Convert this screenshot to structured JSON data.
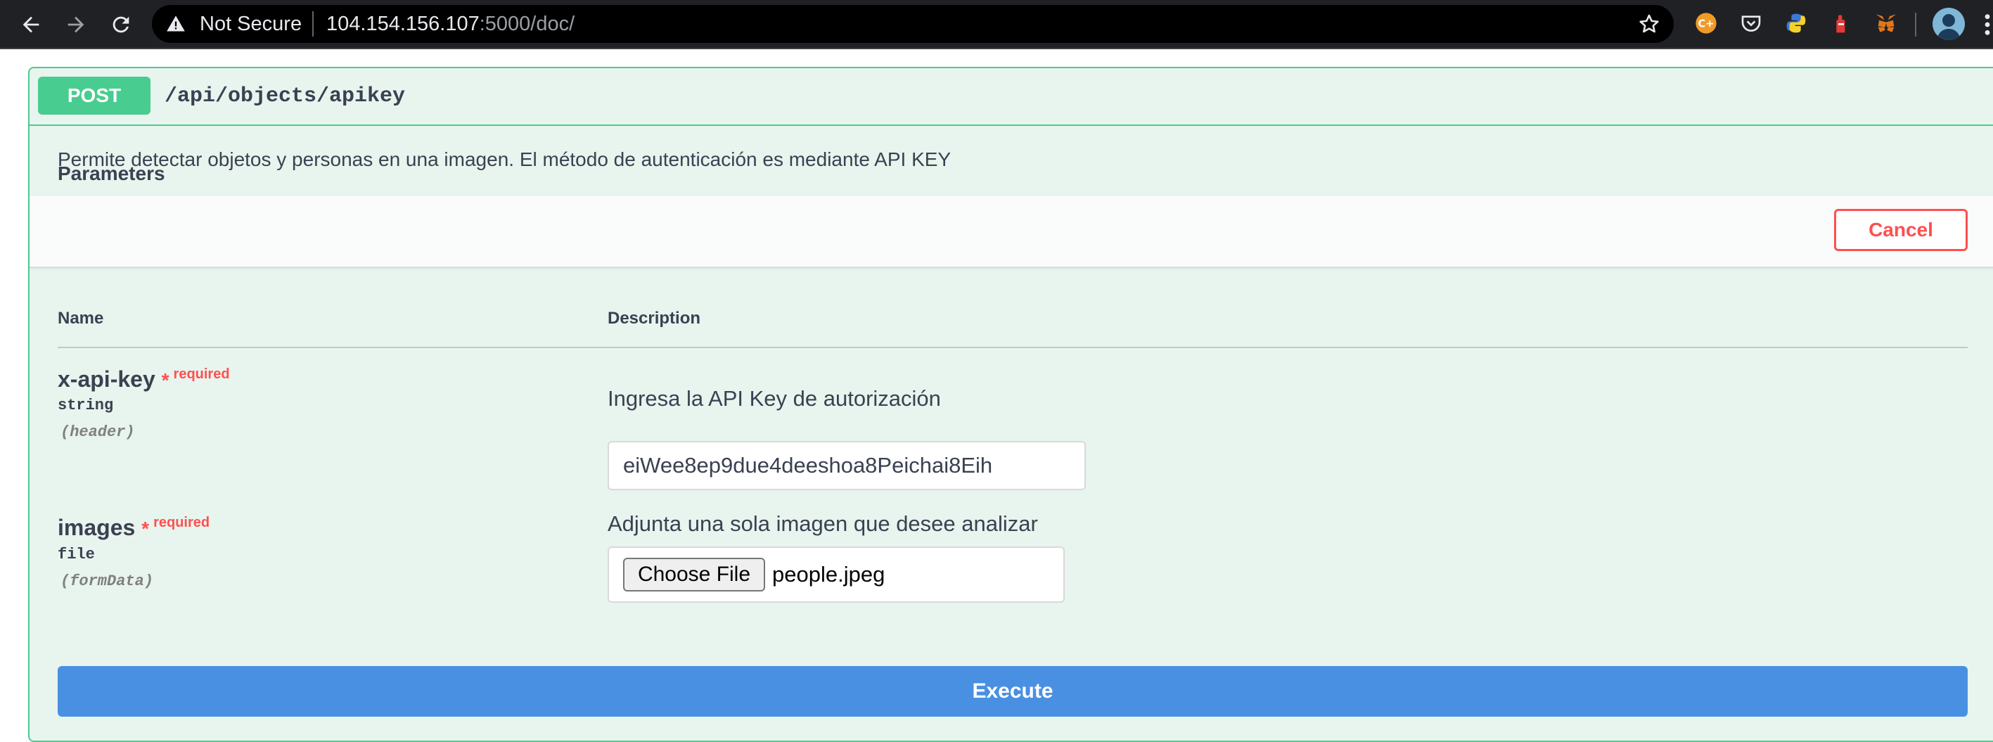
{
  "browser": {
    "security_label": "Not Secure",
    "url_host": "104.154.156.107",
    "url_rest": ":5000/doc/",
    "icons": [
      "back-arrow-icon",
      "forward-arrow-icon",
      "reload-icon",
      "warning-triangle-icon",
      "star-icon",
      "menu-dots-icon"
    ],
    "extensions": [
      "cpp-extension-icon",
      "pocket-icon",
      "python-icon",
      "stop-hand-icon",
      "metamask-fox-icon"
    ]
  },
  "operation": {
    "method": "POST",
    "path": "/api/objects/apikey",
    "description": "Permite detectar objetos y personas en una imagen. El método de autenticación es mediante API KEY"
  },
  "parameters": {
    "title": "Parameters",
    "cancel_label": "Cancel",
    "col_name": "Name",
    "col_description": "Description",
    "items": [
      {
        "name": "x-api-key",
        "star": "*",
        "required": "required",
        "type": "string",
        "in": "(header)",
        "description": "Ingresa la API Key de autorización",
        "value": "eiWee8ep9due4deeshoa8Peichai8Eih"
      },
      {
        "name": "images",
        "star": "*",
        "required": "required",
        "type": "file",
        "in": "(formData)",
        "description": "Adjunta una sola imagen que desee analizar",
        "button_label": "Choose File",
        "file_name": "people.jpeg"
      }
    ]
  },
  "execute_label": "Execute",
  "colors": {
    "post_green": "#49cc90",
    "block_bg": "#e8f4ee",
    "cancel_red": "#ff4f4f",
    "execute_blue": "#4990e2"
  }
}
